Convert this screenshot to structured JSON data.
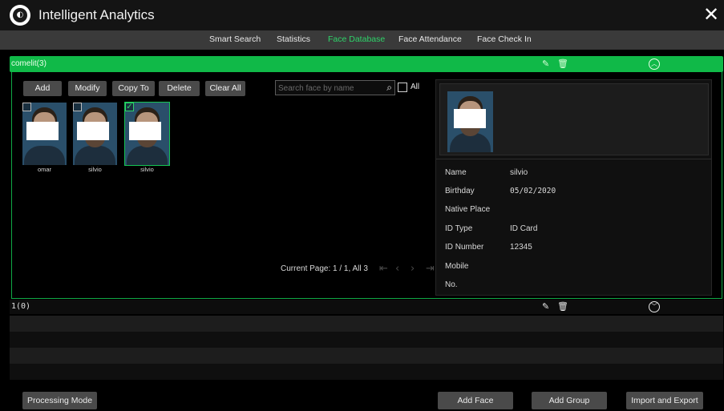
{
  "window": {
    "title": "Intelligent Analytics",
    "close_glyph": "✕",
    "logo_icon": "globe-logo-icon"
  },
  "nav": {
    "tabs": [
      {
        "label": "Smart Search"
      },
      {
        "label": "Statistics"
      },
      {
        "label": "Face Database",
        "active": true
      },
      {
        "label": "Face Attendance"
      },
      {
        "label": "Face Check In"
      }
    ],
    "active_color": "#2fd36a"
  },
  "group1": {
    "title": "comelit(3)",
    "accent_color": "#10b948",
    "icons": [
      "edit-icon",
      "delete-icon",
      "collapse-icon"
    ],
    "toolbar": {
      "add": "Add",
      "modify": "Modify",
      "copy_to": "Copy To",
      "delete": "Delete",
      "clear_all": "Clear All"
    },
    "search": {
      "placeholder": "Search face by name",
      "all_label": "All"
    },
    "faces": [
      {
        "name": "omar",
        "selected": false
      },
      {
        "name": "silvio",
        "selected": false
      },
      {
        "name": "silvio",
        "selected": true
      }
    ],
    "pager": {
      "text": "Current Page: 1 / 1, All 3"
    },
    "details": {
      "fields": [
        {
          "label": "Name",
          "value": "silvio"
        },
        {
          "label": "Birthday",
          "value": "05/02/2020"
        },
        {
          "label": "Native Place",
          "value": ""
        },
        {
          "label": "ID Type",
          "value": "ID Card"
        },
        {
          "label": "ID Number",
          "value": "12345"
        },
        {
          "label": "Mobile",
          "value": ""
        },
        {
          "label": "No.",
          "value": ""
        }
      ]
    }
  },
  "group2": {
    "title": "1(0)",
    "icons": [
      "edit-icon",
      "delete-icon",
      "expand-icon"
    ]
  },
  "footer": {
    "processing_mode": "Processing Mode",
    "add_face": "Add Face",
    "add_group": "Add Group",
    "import_export": "Import and Export"
  }
}
